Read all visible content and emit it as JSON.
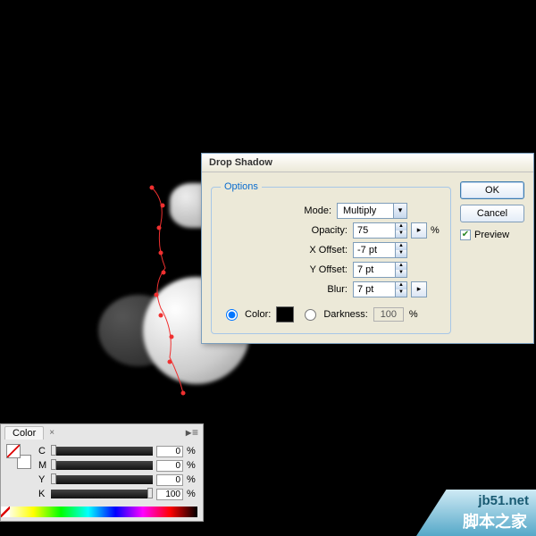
{
  "dialog": {
    "title": "Drop Shadow",
    "options_legend": "Options",
    "mode_label": "Mode:",
    "mode_value": "Multiply",
    "opacity_label": "Opacity:",
    "opacity_value": "75",
    "xoff_label": "X Offset:",
    "xoff_value": "-7 pt",
    "yoff_label": "Y Offset:",
    "yoff_value": "7 pt",
    "blur_label": "Blur:",
    "blur_value": "7 pt",
    "pct": "%",
    "color_label": "Color:",
    "darkness_label": "Darkness:",
    "darkness_value": "100",
    "color_selected": true
  },
  "side": {
    "ok": "OK",
    "cancel": "Cancel",
    "preview": "Preview",
    "preview_checked": true
  },
  "color_panel": {
    "tab": "Color",
    "channels": [
      {
        "label": "C",
        "value": "0"
      },
      {
        "label": "M",
        "value": "0"
      },
      {
        "label": "Y",
        "value": "0"
      },
      {
        "label": "K",
        "value": "100"
      }
    ],
    "pct": "%"
  },
  "watermark": {
    "line1": "jb51.net",
    "line2": "脚本之家"
  },
  "chart_data": {
    "type": "table",
    "title": "Drop Shadow effect parameters",
    "rows": [
      {
        "param": "Mode",
        "value": "Multiply"
      },
      {
        "param": "Opacity",
        "value": 75,
        "unit": "%"
      },
      {
        "param": "X Offset",
        "value": -7,
        "unit": "pt"
      },
      {
        "param": "Y Offset",
        "value": 7,
        "unit": "pt"
      },
      {
        "param": "Blur",
        "value": 7,
        "unit": "pt"
      },
      {
        "param": "Color",
        "value": "#000000"
      },
      {
        "param": "Darkness",
        "value": 100,
        "unit": "%",
        "enabled": false
      }
    ]
  }
}
